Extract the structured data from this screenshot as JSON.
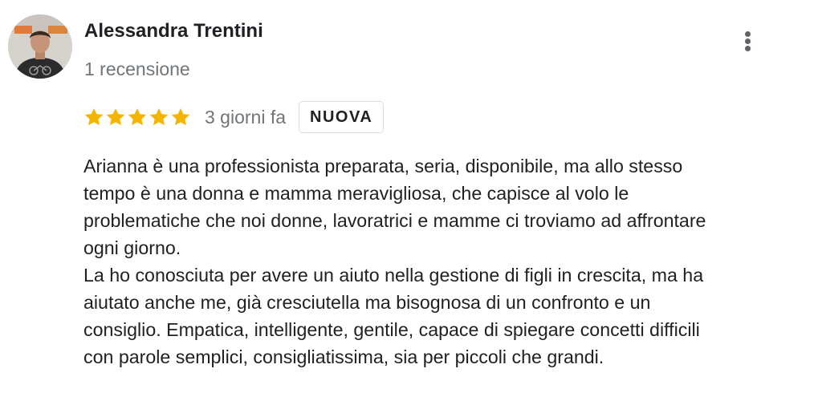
{
  "review": {
    "author": {
      "name": "Alessandra Trentini",
      "meta": "1 recensione",
      "avatar_icon": "user-photo-avatar"
    },
    "more_icon": "more-vertical-icon",
    "rating": {
      "stars": 5,
      "max_stars": 5,
      "star_color": "#F4B400",
      "star_icon": "star-icon"
    },
    "date": "3 giorni fa",
    "badge": "NUOVA",
    "text_lines": [
      "Arianna è una professionista preparata, seria, disponibile, ma allo stesso",
      "tempo è una donna e mamma meravigliosa, che capisce al volo le",
      "problematiche che noi donne, lavoratrici e mamme ci troviamo ad affrontare",
      "ogni giorno.",
      "La ho conosciuta per avere un aiuto nella gestione di figli in crescita, ma ha",
      "aiutato anche me, già cresciutella ma bisognosa di un confronto e un",
      "consiglio. Empatica, intelligente, gentile, capace di spiegare concetti difficili",
      "con parole semplici, consigliatissima, sia per piccoli che grandi."
    ]
  }
}
